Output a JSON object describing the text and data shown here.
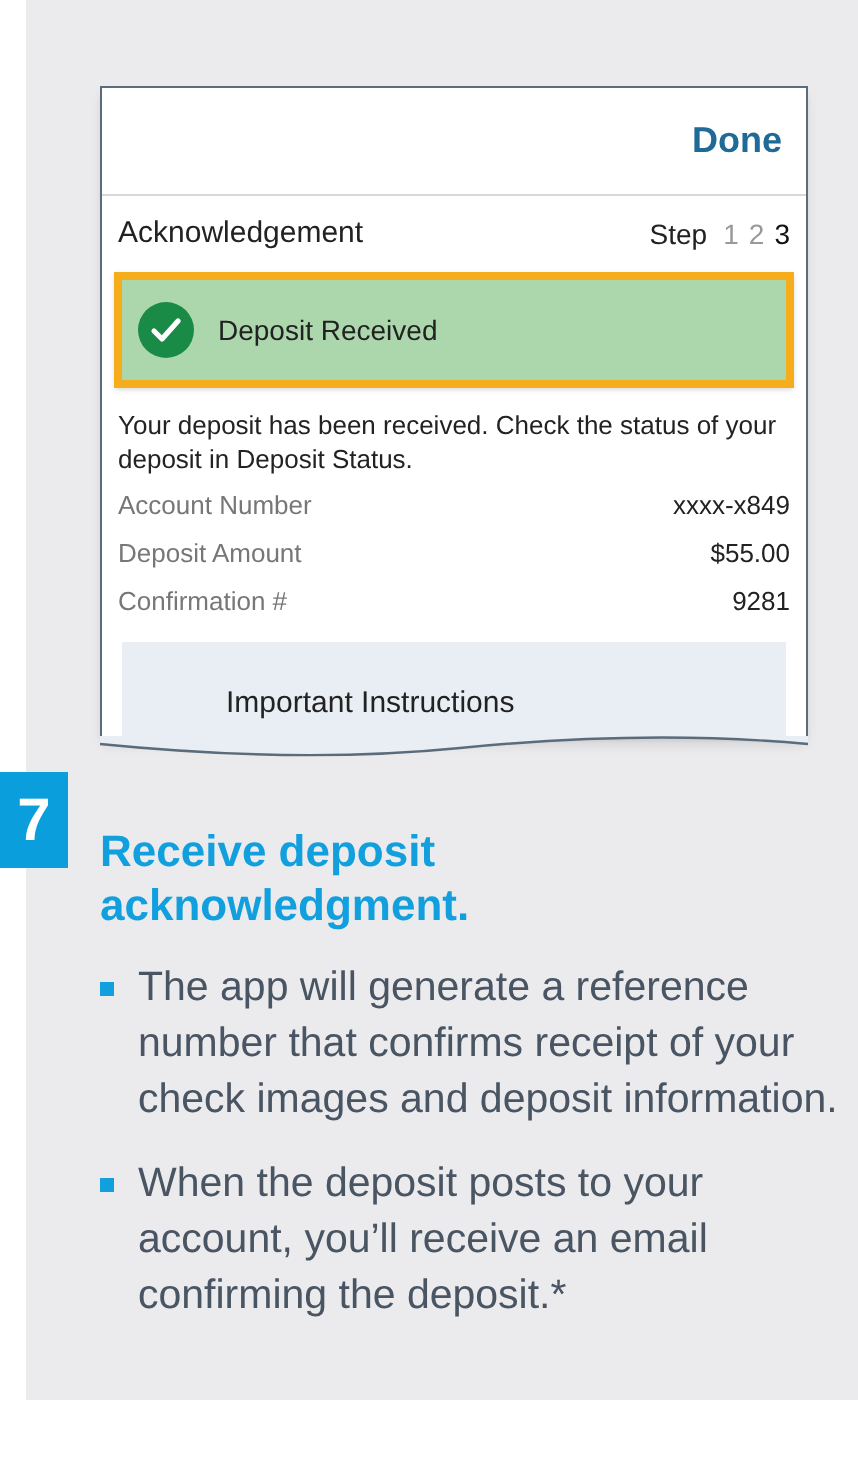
{
  "phone_screen": {
    "done_button": "Done",
    "title": "Acknowledgement",
    "step_label": "Step",
    "steps": [
      {
        "label": "1",
        "selected": false
      },
      {
        "label": "2",
        "selected": false
      },
      {
        "label": "3",
        "selected": true
      }
    ],
    "banner": {
      "text": "Deposit Received",
      "highlighted": true
    },
    "message": "Your deposit has been received. Check the status of your deposit in Deposit Status.",
    "details": [
      {
        "label": "Account Number",
        "value": "xxxx-x849"
      },
      {
        "label": "Deposit Amount",
        "value": "$55.00"
      },
      {
        "label": "Confirmation #",
        "value": "9281"
      }
    ],
    "instructions_title": "Important Instructions"
  },
  "step_number": "7",
  "heading": "Receive deposit acknowledgment.",
  "bullets": [
    "The app will generate a reference number that confirms receipt of your check images and deposit information.",
    "When the deposit posts to your account, you’ll receive an email confirming the deposit.*"
  ]
}
